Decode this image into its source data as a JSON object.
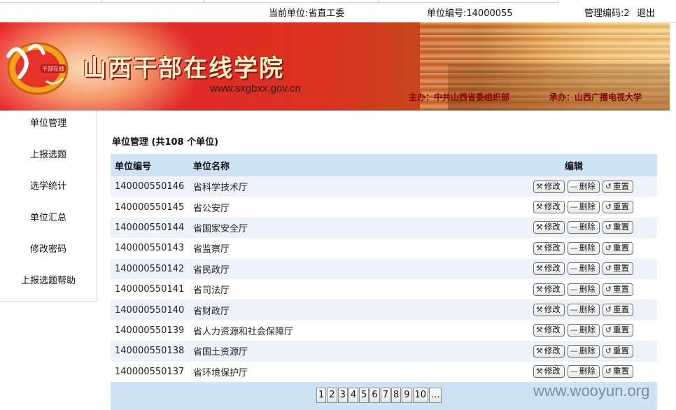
{
  "top": {
    "current_unit": "当前单位:省直工委",
    "unit_code": "单位编号:14000055",
    "admin_code": "管理编码:2",
    "logout": "退出"
  },
  "banner": {
    "title": "山西干部在线学院",
    "url": "www.sxgbxx.gov.cn",
    "host": "主办：中共山西省委组织部",
    "organizer": "承办：山西广播电视大学",
    "logo_text": "干部在线"
  },
  "sidebar": {
    "items": [
      {
        "label": "单位管理"
      },
      {
        "label": "上报选题"
      },
      {
        "label": "选学统计"
      },
      {
        "label": "单位汇总"
      },
      {
        "label": "修改密码"
      },
      {
        "label": "上报选题帮助"
      }
    ]
  },
  "main": {
    "heading": "单位管理 (共108 个单位)",
    "columns": [
      "单位编号",
      "单位名称",
      "编辑"
    ],
    "actions": {
      "edit": "修改",
      "delete": "删除",
      "reset": "重置"
    },
    "rows": [
      {
        "code": "140000550146",
        "name": "省科学技术厅"
      },
      {
        "code": "140000550145",
        "name": "省公安厅"
      },
      {
        "code": "140000550144",
        "name": "省国家安全厅"
      },
      {
        "code": "140000550143",
        "name": "省监察厅"
      },
      {
        "code": "140000550142",
        "name": "省民政厅"
      },
      {
        "code": "140000550141",
        "name": "省司法厅"
      },
      {
        "code": "140000550140",
        "name": "省财政厅"
      },
      {
        "code": "140000550139",
        "name": "省人力资源和社会保障厅"
      },
      {
        "code": "140000550138",
        "name": "省国土资源厅"
      },
      {
        "code": "140000550137",
        "name": "省环境保护厅"
      }
    ]
  },
  "pager": {
    "pages": [
      "1",
      "2",
      "3",
      "4",
      "5",
      "6",
      "7",
      "8",
      "9",
      "10",
      "..."
    ],
    "current": "1"
  },
  "watermark": "www.wooyun.org",
  "colors": {
    "header_bg": "#cfe3f6",
    "row_alt": "#eef2fa",
    "banner_red": "#e02a25",
    "sponsor_text": "#8a0000"
  }
}
